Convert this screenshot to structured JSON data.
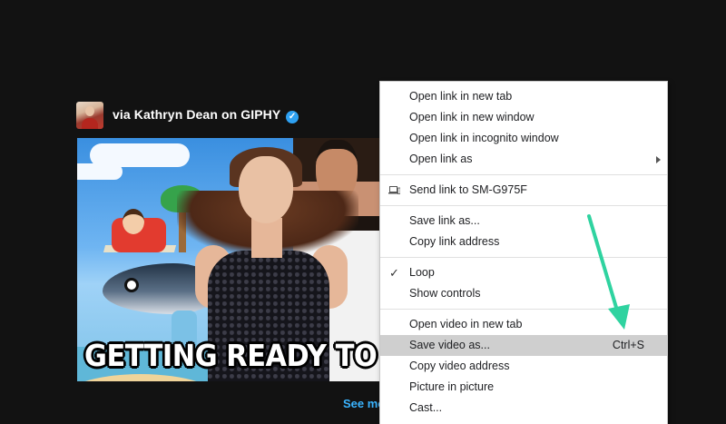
{
  "attribution": {
    "text": "via Kathryn Dean on GIPHY",
    "verified_glyph": "✓"
  },
  "gif": {
    "caption": "GETTING READY TO GO M"
  },
  "see_more": "See mo",
  "context_menu": {
    "groups": [
      {
        "items": [
          {
            "label": "Open link in new tab"
          },
          {
            "label": "Open link in new window"
          },
          {
            "label": "Open link in incognito window"
          },
          {
            "label": "Open link as",
            "submenu": true
          }
        ]
      },
      {
        "items": [
          {
            "label": "Send link to SM-G975F",
            "icon": "device-icon"
          }
        ]
      },
      {
        "items": [
          {
            "label": "Save link as..."
          },
          {
            "label": "Copy link address"
          }
        ]
      },
      {
        "items": [
          {
            "label": "Loop",
            "checked": true
          },
          {
            "label": "Show controls"
          }
        ]
      },
      {
        "items": [
          {
            "label": "Open video in new tab"
          },
          {
            "label": "Save video as...",
            "shortcut": "Ctrl+S",
            "highlighted": true
          },
          {
            "label": "Copy video address"
          },
          {
            "label": "Picture in picture"
          },
          {
            "label": "Cast..."
          }
        ]
      }
    ],
    "check_glyph": "✓"
  },
  "annotation": {
    "arrow_color": "#2fd3a0"
  }
}
